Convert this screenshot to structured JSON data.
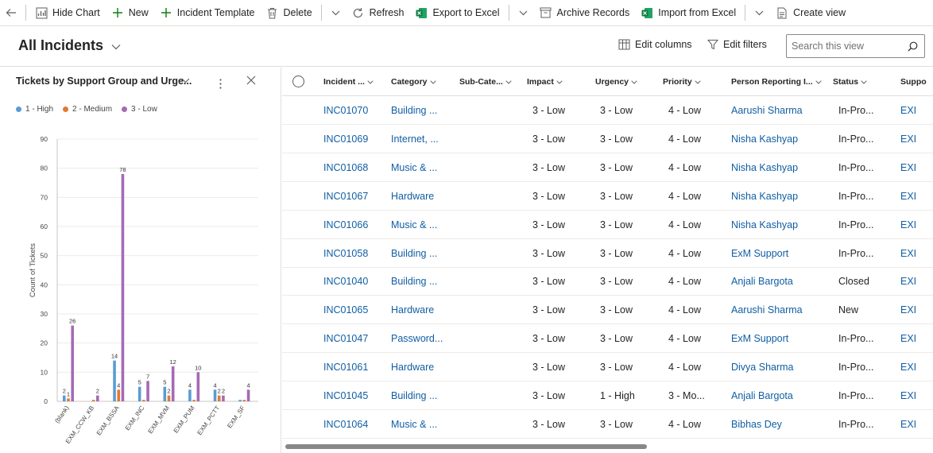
{
  "commandbar": {
    "hide_chart": "Hide Chart",
    "new": "New",
    "incident_template": "Incident Template",
    "delete": "Delete",
    "refresh": "Refresh",
    "export_excel": "Export to Excel",
    "archive_records": "Archive Records",
    "import_excel": "Import from Excel",
    "create_view": "Create view"
  },
  "view": {
    "title": "All Incidents",
    "edit_columns": "Edit columns",
    "edit_filters": "Edit filters",
    "search_placeholder": "Search this view"
  },
  "chart_panel": {
    "title": "Tickets by Support Group and Urge..."
  },
  "chart_data": {
    "type": "bar",
    "title": "Tickets by Support Group and Urge...",
    "xlabel": "",
    "ylabel": "Count of Tickets",
    "ylim": [
      0,
      90
    ],
    "yticks": [
      0,
      10,
      20,
      30,
      40,
      50,
      60,
      70,
      80,
      90
    ],
    "grid": true,
    "legend_position": "top-left",
    "categories": [
      "(blank)",
      "EXM_CCW_KB",
      "EXM_BSSA",
      "EXM_INC",
      "EXM_MVM",
      "EXM_PUM",
      "EXM_PCTT",
      "EXM_SF"
    ],
    "series": [
      {
        "name": "1 - High",
        "color": "#5b9bd5",
        "values": [
          2,
          0,
          14,
          5,
          5,
          4,
          4,
          0.5
        ],
        "labels": [
          "2",
          "",
          "14",
          "5",
          "5",
          "4",
          "4",
          ""
        ]
      },
      {
        "name": "2 - Medium",
        "color": "#e07a2f",
        "values": [
          1,
          0.5,
          4,
          0.5,
          2,
          0.5,
          2,
          0.5
        ],
        "labels": [
          "1",
          "",
          "4",
          "",
          "2",
          "",
          "2",
          ""
        ]
      },
      {
        "name": "3 - Low",
        "color": "#a56ab5",
        "values": [
          26,
          2,
          78,
          7,
          12,
          10,
          2,
          4
        ],
        "labels": [
          "26",
          "2",
          "78",
          "7",
          "12",
          "10",
          "2",
          "4"
        ]
      }
    ]
  },
  "grid": {
    "columns": [
      "Incident ...",
      "Category",
      "Sub-Cate...",
      "Impact",
      "Urgency",
      "Priority",
      "Person Reporting I...",
      "Status",
      "Suppo"
    ],
    "rows": [
      {
        "id": "INC01070",
        "category": "Building ...",
        "subcategory": "",
        "impact": "3 - Low",
        "urgency": "3 - Low",
        "priority": "4 - Low",
        "person": "Aarushi Sharma",
        "status": "In-Pro...",
        "support": "EXI"
      },
      {
        "id": "INC01069",
        "category": "Internet, ...",
        "subcategory": "",
        "impact": "3 - Low",
        "urgency": "3 - Low",
        "priority": "4 - Low",
        "person": "Nisha Kashyap",
        "status": "In-Pro...",
        "support": "EXI"
      },
      {
        "id": "INC01068",
        "category": "Music & ...",
        "subcategory": "",
        "impact": "3 - Low",
        "urgency": "3 - Low",
        "priority": "4 - Low",
        "person": "Nisha Kashyap",
        "status": "In-Pro...",
        "support": "EXI"
      },
      {
        "id": "INC01067",
        "category": "Hardware",
        "subcategory": "",
        "impact": "3 - Low",
        "urgency": "3 - Low",
        "priority": "4 - Low",
        "person": "Nisha Kashyap",
        "status": "In-Pro...",
        "support": "EXI"
      },
      {
        "id": "INC01066",
        "category": "Music & ...",
        "subcategory": "",
        "impact": "3 - Low",
        "urgency": "3 - Low",
        "priority": "4 - Low",
        "person": "Nisha Kashyap",
        "status": "In-Pro...",
        "support": "EXI"
      },
      {
        "id": "INC01058",
        "category": "Building ...",
        "subcategory": "",
        "impact": "3 - Low",
        "urgency": "3 - Low",
        "priority": "4 - Low",
        "person": "ExM Support",
        "status": "In-Pro...",
        "support": "EXI"
      },
      {
        "id": "INC01040",
        "category": "Building ...",
        "subcategory": "",
        "impact": "3 - Low",
        "urgency": "3 - Low",
        "priority": "4 - Low",
        "person": "Anjali Bargota",
        "status": "Closed",
        "support": "EXI"
      },
      {
        "id": "INC01065",
        "category": "Hardware",
        "subcategory": "",
        "impact": "3 - Low",
        "urgency": "3 - Low",
        "priority": "4 - Low",
        "person": "Aarushi Sharma",
        "status": "New",
        "support": "EXI"
      },
      {
        "id": "INC01047",
        "category": "Password...",
        "subcategory": "",
        "impact": "3 - Low",
        "urgency": "3 - Low",
        "priority": "4 - Low",
        "person": "ExM Support",
        "status": "In-Pro...",
        "support": "EXI"
      },
      {
        "id": "INC01061",
        "category": "Hardware",
        "subcategory": "",
        "impact": "3 - Low",
        "urgency": "3 - Low",
        "priority": "4 - Low",
        "person": "Divya Sharma",
        "status": "In-Pro...",
        "support": "EXI"
      },
      {
        "id": "INC01045",
        "category": "Building ...",
        "subcategory": "",
        "impact": "3 - Low",
        "urgency": "1 - High",
        "priority": "3 - Mo...",
        "person": "Anjali Bargota",
        "status": "In-Pro...",
        "support": "EXI"
      },
      {
        "id": "INC01064",
        "category": "Music & ...",
        "subcategory": "",
        "impact": "3 - Low",
        "urgency": "3 - Low",
        "priority": "4 - Low",
        "person": "Bibhas Dey",
        "status": "In-Pro...",
        "support": "EXI"
      }
    ]
  }
}
